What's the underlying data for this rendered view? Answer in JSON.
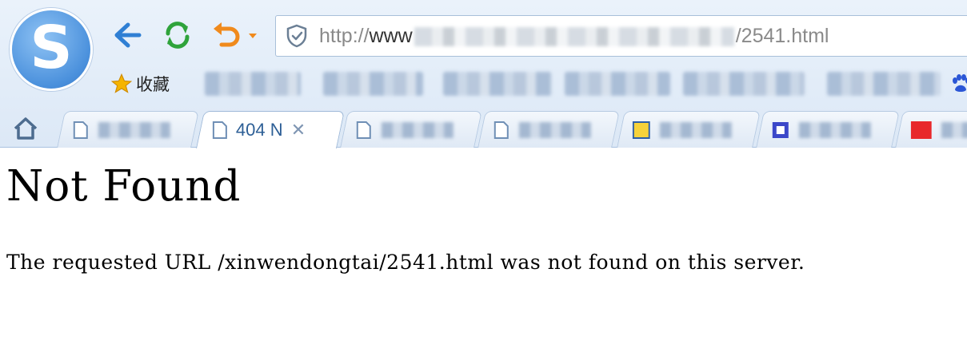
{
  "browser": {
    "logo_letter": "S",
    "address": {
      "prefix": "http://",
      "host_visible": "www",
      "suffix": "/2541.html"
    },
    "bookmarks": {
      "favorites_label": "收藏"
    },
    "tabs": [
      {
        "label": "",
        "active": false
      },
      {
        "label": "404 N",
        "active": true
      },
      {
        "label": "",
        "active": false
      },
      {
        "label": "",
        "active": false
      },
      {
        "label": "",
        "active": false
      },
      {
        "label": "",
        "active": false
      },
      {
        "label": "",
        "active": false
      }
    ],
    "close_glyph": "✕"
  },
  "page": {
    "heading": "Not Found",
    "message": "The requested URL /xinwendongtai/2541.html was not found on this server."
  },
  "colors": {
    "back_arrow": "#2f7fd4",
    "refresh": "#2fa33b",
    "undo": "#f08a1c",
    "tab_text": "#2d5f96",
    "star": "#f5b400"
  }
}
